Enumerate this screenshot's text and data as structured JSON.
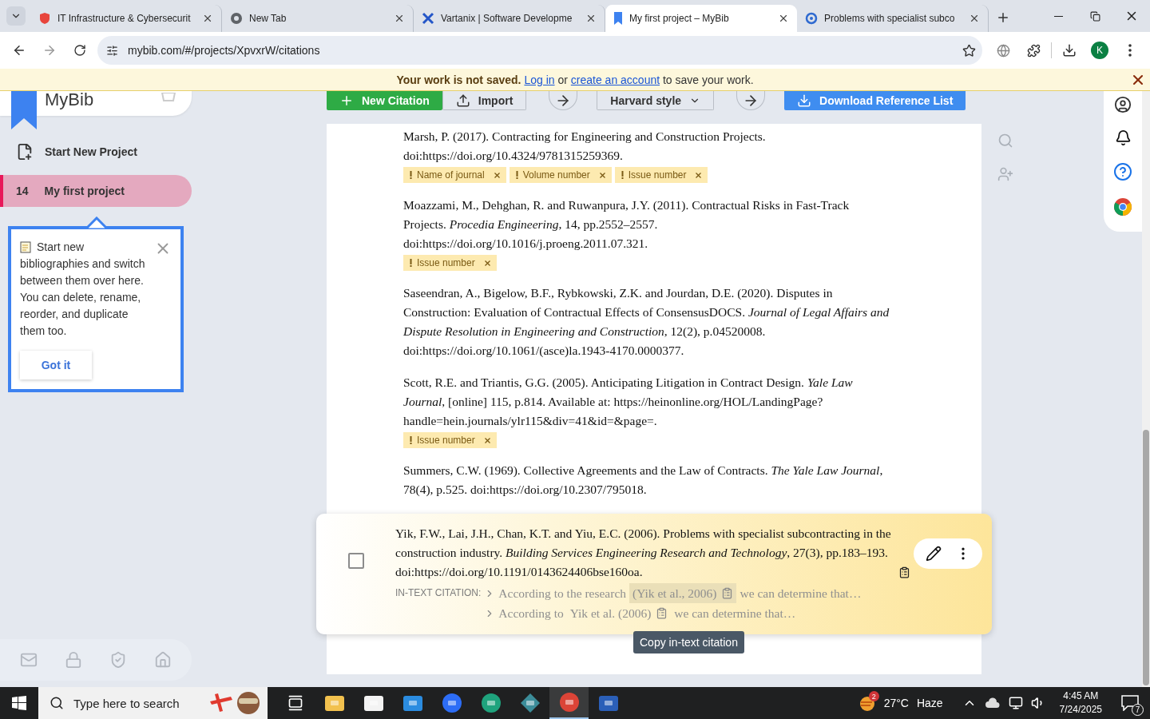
{
  "browser": {
    "tabs": [
      {
        "title": "IT Infrastructure & Cybersecurit",
        "kind": "shield",
        "selected": false
      },
      {
        "title": "New Tab",
        "kind": "globe",
        "selected": false
      },
      {
        "title": "Vartanix | Software Developme",
        "kind": "cross",
        "selected": false
      },
      {
        "title": "My first project – MyBib",
        "kind": "bookmark",
        "selected": true
      },
      {
        "title": "Problems with specialist subco",
        "kind": "ring",
        "selected": false
      }
    ],
    "url": "mybib.com/#/projects/XpvxrW/citations",
    "profile_initial": "K"
  },
  "notice": {
    "bold": "Your work is not saved.",
    "login_link": "Log in",
    "middle": "or",
    "signup_link": "create an account",
    "rest": "to save your work."
  },
  "sidebar": {
    "logo": "MyBib",
    "new_project": "Start New Project",
    "projects": [
      {
        "count": "14",
        "name": "My first project",
        "selected": true
      }
    ],
    "onboarding": {
      "text": "Start new bibliographies and switch between them over here. You can delete, rename, reorder, and duplicate them too.",
      "button": "Got it"
    }
  },
  "toolbar": {
    "new_citation": "New Citation",
    "import": "Import",
    "style": "Harvard style",
    "download": "Download Reference List"
  },
  "citations": [
    {
      "text": "Marsh, P. (2017). Contracting for Engineering and Construction Projects. doi:https://doi.org/10.4324/9781315259369.",
      "warnings": [
        "Name of journal",
        "Volume number",
        "Issue number"
      ],
      "highlighted": false
    },
    {
      "text": "Moazzami, M., Dehghan, R. and Ruwanpura, J.Y. (2011). Contractual Risks in Fast-Track Projects. *Procedia Engineering*, 14, pp.2552–2557. doi:https://doi.org/10.1016/j.proeng.2011.07.321.",
      "warnings": [
        "Issue number"
      ],
      "highlighted": false
    },
    {
      "text": "Saseendran, A., Bigelow, B.F., Rybkowski, Z.K. and Jourdan, D.E. (2020). Disputes in Construction: Evaluation of Contractual Effects of ConsensusDOCS. *Journal of Legal Affairs and Dispute Resolution in Engineering and Construction*, 12(2), p.04520008. doi:https://doi.org/10.1061/(asce)la.1943-4170.0000377.",
      "highlighted": false
    },
    {
      "text": "Scott, R.E. and Triantis, G.G. (2005). Anticipating Litigation in Contract Design. *Yale Law Journal*, [online] 115, p.814. Available at: https://heinonline.org/HOL/LandingPage? handle=hein.journals/ylr115&div=41&id=&page=.",
      "warnings": [
        "Issue number"
      ],
      "highlighted": false
    },
    {
      "text": "Summers, C.W. (1969). Collective Agreements and the Law of Contracts. *The Yale Law Journal*, 78(4), p.525. doi:https://doi.org/10.2307/795018.",
      "highlighted": false
    },
    {
      "text": "Yik, F.W., Lai, J.H., Chan, K.T. and Yiu, E.C. (2006). Problems with specialist subcontracting in the construction industry. *Building Services Engineering Research and Technology*, 27(3), pp.183–193. doi:https://doi.org/10.1191/0143624406bse160oa.",
      "highlighted": true,
      "checked": false,
      "in_text": {
        "label": "IN-TEXT CITATION:",
        "lines": [
          {
            "before": "According to the research",
            "citation": "(Yik et al., 2006)",
            "after": "we can determine that…",
            "active": true
          },
          {
            "before": "According to",
            "citation": "Yik et al. (2006)",
            "after": "we can determine that…",
            "active": false
          }
        ]
      },
      "tooltip": "Copy in-text citation"
    }
  ],
  "taskbar": {
    "search_placeholder": "Type here to search",
    "weather": {
      "temperature": "27°C",
      "condition": "Haze",
      "badge": "2"
    },
    "time": "4:45 AM",
    "date": "7/24/2025",
    "notifications": "7"
  }
}
